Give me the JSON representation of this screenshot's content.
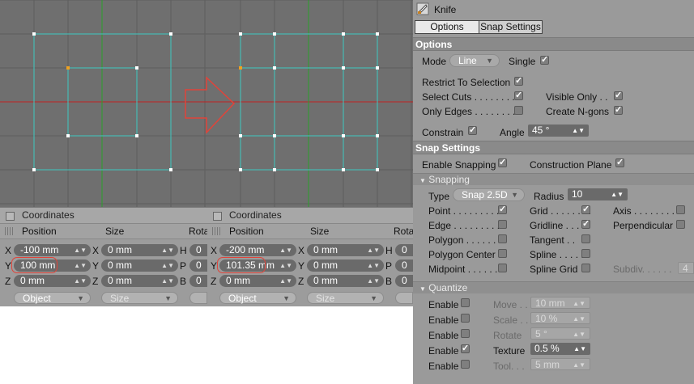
{
  "coordinates": [
    {
      "title": "Coordinates",
      "col_position": "Position",
      "col_size": "Size",
      "col_rotation": "Rota",
      "rows": [
        {
          "axis": "X",
          "pos": "-100 mm",
          "size_axis": "X",
          "size": "0 mm",
          "rot_axis": "H",
          "rot": "0"
        },
        {
          "axis": "Y",
          "pos": "100 mm",
          "size_axis": "Y",
          "size": "0 mm",
          "rot_axis": "P",
          "rot": "0"
        },
        {
          "axis": "Z",
          "pos": "0 mm",
          "size_axis": "Z",
          "size": "0 mm",
          "rot_axis": "B",
          "rot": "0"
        }
      ],
      "mode": "Object",
      "size_mode": "Size"
    },
    {
      "title": "Coordinates",
      "col_position": "Position",
      "col_size": "Size",
      "col_rotation": "Rota",
      "rows": [
        {
          "axis": "X",
          "pos": "-200 mm",
          "size_axis": "X",
          "size": "0 mm",
          "rot_axis": "H",
          "rot": "0"
        },
        {
          "axis": "Y",
          "pos": "101.35 mm",
          "size_axis": "Y",
          "size": "0 mm",
          "rot_axis": "P",
          "rot": "0"
        },
        {
          "axis": "Z",
          "pos": "0 mm",
          "size_axis": "Z",
          "size": "0 mm",
          "rot_axis": "B",
          "rot": "0"
        }
      ],
      "mode": "Object",
      "size_mode": "Size"
    }
  ],
  "panel": {
    "tool_title": "Knife",
    "tool_icon": "knife-icon",
    "tabs": [
      "Options",
      "Snap Settings"
    ],
    "options": {
      "header": "Options",
      "mode_label": "Mode",
      "mode_value": "Line",
      "single_label": "Single",
      "single": true,
      "restrict_label": "Restrict To Selection",
      "restrict": true,
      "select_cuts_label": "Select Cuts . . . . . . . .",
      "select_cuts": true,
      "visible_only_label": "Visible Only . .",
      "visible_only": true,
      "only_edges_label": "Only Edges . . . . . . . .",
      "only_edges": false,
      "create_ngons_label": "Create N-gons",
      "create_ngons": true,
      "constrain_label": "Constrain",
      "constrain": true,
      "angle_label": "Angle",
      "angle_value": "45 °"
    },
    "snap": {
      "header": "Snap Settings",
      "enable_label": "Enable Snapping",
      "enable": true,
      "plane_label": "Construction Plane",
      "plane": true,
      "snapping_header": "Snapping",
      "type_label": "Type",
      "type_value": "Snap 2.5D",
      "radius_label": "Radius",
      "radius_value": "10",
      "point_label": "Point . . . . . . . . .",
      "point": true,
      "grid_label": "Grid . . . . . . . .",
      "grid": true,
      "axis_label": "Axis . . . . . . . .",
      "axis": false,
      "edge_label": "Edge . . . . . . . . .",
      "edge": false,
      "gridline_label": "Gridline . . . .",
      "gridline": true,
      "perp_label": "Perpendicular",
      "perp": false,
      "polygon_label": "Polygon . . . . . .",
      "polygon": false,
      "tangent_label": "Tangent . .",
      "tangent": false,
      "polycenter_label": "Polygon Center",
      "polycenter": false,
      "spline_label": "Spline . . . . .",
      "spline": false,
      "midpoint_label": "Midpoint . . . . . .",
      "midpoint": false,
      "splinegrid_label": "Spline Grid",
      "splinegrid": false,
      "subdiv_label": "Subdiv. . . . . .",
      "subdiv_value": "4"
    },
    "quantize": {
      "header": "Quantize",
      "rows": [
        {
          "enable_label": "Enable",
          "enabled": false,
          "label": "Move . .",
          "value": "10 mm",
          "active": false
        },
        {
          "enable_label": "Enable",
          "enabled": false,
          "label": "Scale . .",
          "value": "10 %",
          "active": false
        },
        {
          "enable_label": "Enable",
          "enabled": false,
          "label": "Rotate",
          "value": "5 °",
          "active": false
        },
        {
          "enable_label": "Enable",
          "enabled": true,
          "label": "Texture",
          "value": "0.5 %",
          "active": true
        },
        {
          "enable_label": "Enable",
          "enabled": false,
          "label": "Tool. . .",
          "value": "5 mm",
          "active": false
        }
      ]
    }
  },
  "colors": {
    "viewport_bg": "#6f6f6f",
    "mesh": "#3ec9c2",
    "vertex": "#ffffff",
    "selected_vertex": "#f0a020",
    "x_axis": "#c02020",
    "y_axis": "#2aa02a",
    "annotation": "#e0443a"
  },
  "icons": {
    "arrow": "right-arrow-annotation",
    "dropdown": "chevron-down-icon",
    "stepper": "stepper-arrows-icon"
  }
}
